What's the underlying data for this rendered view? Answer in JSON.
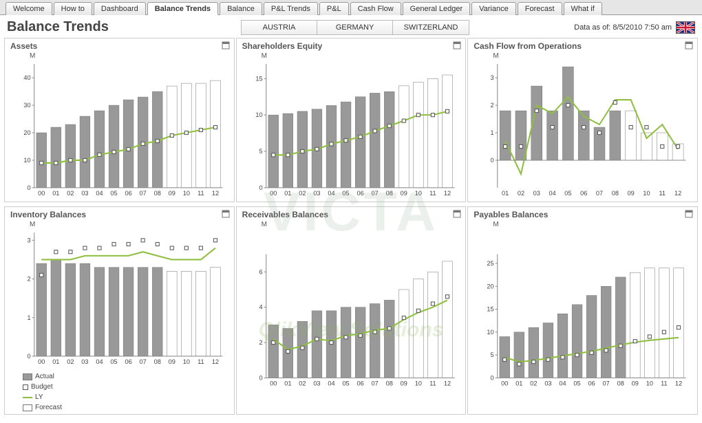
{
  "tabs": [
    "Welcome",
    "How to",
    "Dashboard",
    "Balance Trends",
    "Balance",
    "P&L Trends",
    "P&L",
    "Cash Flow",
    "General Ledger",
    "Variance",
    "Forecast",
    "What if"
  ],
  "active_tab_index": 3,
  "page_title": "Balance Trends",
  "countries": [
    "AUSTRIA",
    "GERMANY",
    "SWITZERLAND"
  ],
  "data_as_of": "Data as of: 8/5/2010 7:50 am",
  "unit": "M",
  "legend": {
    "actual": "Actual",
    "budget": "Budget",
    "ly": "LY",
    "forecast": "Forecast"
  },
  "watermark": "VICTA",
  "watermark2": "QlikView Solutions",
  "chart_data": [
    {
      "title": "Assets",
      "type": "bar",
      "ylim": [
        0,
        45
      ],
      "yticks": [
        0,
        10,
        20,
        30,
        40
      ],
      "categories": [
        "00",
        "01",
        "02",
        "03",
        "04",
        "05",
        "06",
        "07",
        "08",
        "09",
        "10",
        "11",
        "12"
      ],
      "actual": [
        20,
        22,
        23,
        26,
        28,
        30,
        32,
        33,
        35,
        null,
        null,
        null,
        null
      ],
      "forecast": [
        null,
        null,
        null,
        null,
        null,
        null,
        null,
        null,
        null,
        37,
        38,
        38,
        39
      ],
      "budget": [
        9,
        9,
        10,
        10,
        12,
        13,
        14,
        16,
        17,
        19,
        20,
        21,
        22
      ],
      "ly": [
        9,
        9,
        10,
        10,
        12,
        13,
        14,
        16,
        17,
        19,
        20,
        21,
        22
      ]
    },
    {
      "title": "Shareholders Equity",
      "type": "bar",
      "ylim": [
        0,
        17
      ],
      "yticks": [
        0,
        5,
        10,
        15
      ],
      "categories": [
        "00",
        "01",
        "02",
        "03",
        "04",
        "05",
        "06",
        "07",
        "08",
        "09",
        "10",
        "11",
        "12"
      ],
      "actual": [
        10,
        10.2,
        10.5,
        10.8,
        11.3,
        11.8,
        12.5,
        13,
        13.2,
        null,
        null,
        null,
        null
      ],
      "forecast": [
        null,
        null,
        null,
        null,
        null,
        null,
        null,
        null,
        null,
        14,
        14.5,
        15,
        15.5
      ],
      "budget": [
        4.5,
        4.5,
        5,
        5.3,
        6,
        6.5,
        7,
        7.8,
        8.5,
        9.2,
        10,
        10,
        10.5
      ],
      "ly": [
        4.5,
        4.5,
        5,
        5.3,
        6,
        6.5,
        7,
        7.8,
        8.5,
        9.2,
        10,
        10,
        10.5
      ]
    },
    {
      "title": "Cash Flow from Operations",
      "type": "bar",
      "ylim": [
        -1,
        3.5
      ],
      "yticks": [
        0,
        1,
        2,
        3
      ],
      "categories": [
        "01",
        "02",
        "03",
        "04",
        "05",
        "06",
        "07",
        "08",
        "09",
        "10",
        "11",
        "12"
      ],
      "actual": [
        1.8,
        1.8,
        2.7,
        1.8,
        3.4,
        1.8,
        1.2,
        1.8,
        null,
        null,
        null,
        null
      ],
      "forecast": [
        null,
        null,
        null,
        null,
        null,
        null,
        null,
        null,
        1.8,
        1.0,
        1.0,
        0.6
      ],
      "budget": [
        0.5,
        0.5,
        1.8,
        1.2,
        2.0,
        1.2,
        1.0,
        2.1,
        1.2,
        1.2,
        0.5,
        0.5
      ],
      "ly": [
        0.7,
        -0.5,
        2.0,
        1.7,
        2.3,
        1.6,
        1.3,
        2.2,
        2.2,
        0.8,
        1.3,
        0.4
      ]
    },
    {
      "title": "Inventory Balances",
      "type": "bar",
      "ylim": [
        0,
        3.2
      ],
      "yticks": [
        0,
        1,
        2,
        3
      ],
      "categories": [
        "00",
        "01",
        "02",
        "03",
        "04",
        "05",
        "06",
        "07",
        "08",
        "09",
        "10",
        "11",
        "12"
      ],
      "actual": [
        2.4,
        2.5,
        2.4,
        2.4,
        2.3,
        2.3,
        2.3,
        2.3,
        2.3,
        null,
        null,
        null,
        null
      ],
      "forecast": [
        null,
        null,
        null,
        null,
        null,
        null,
        null,
        null,
        null,
        2.2,
        2.2,
        2.2,
        2.3
      ],
      "budget": [
        2.1,
        2.7,
        2.7,
        2.8,
        2.8,
        2.9,
        2.9,
        3.0,
        2.9,
        2.8,
        2.8,
        2.8,
        3.0
      ],
      "ly": [
        2.5,
        2.5,
        2.5,
        2.6,
        2.6,
        2.6,
        2.6,
        2.7,
        2.6,
        2.5,
        2.5,
        2.5,
        2.8
      ]
    },
    {
      "title": "Receivables Balances",
      "type": "bar",
      "ylim": [
        0,
        7
      ],
      "yticks": [
        0,
        2,
        4,
        6
      ],
      "categories": [
        "00",
        "01",
        "02",
        "03",
        "04",
        "05",
        "06",
        "07",
        "08",
        "09",
        "10",
        "11",
        "12"
      ],
      "actual": [
        3.0,
        2.8,
        3.2,
        3.8,
        3.8,
        4.0,
        4.0,
        4.2,
        4.4,
        null,
        null,
        null,
        null
      ],
      "forecast": [
        null,
        null,
        null,
        null,
        null,
        null,
        null,
        null,
        null,
        5.0,
        5.6,
        6.0,
        6.6
      ],
      "budget": [
        2.0,
        1.5,
        1.7,
        2.2,
        2.0,
        2.3,
        2.4,
        2.6,
        2.8,
        3.4,
        3.8,
        4.2,
        4.6
      ],
      "ly": [
        2.2,
        1.6,
        1.8,
        2.2,
        2.1,
        2.4,
        2.5,
        2.7,
        2.8,
        3.3,
        3.7,
        4.0,
        4.4
      ]
    },
    {
      "title": "Payables Balances",
      "type": "bar",
      "ylim": [
        0,
        27
      ],
      "yticks": [
        0,
        5,
        10,
        15,
        20,
        25
      ],
      "categories": [
        "00",
        "01",
        "02",
        "03",
        "04",
        "05",
        "06",
        "07",
        "08",
        "09",
        "10",
        "11",
        "12"
      ],
      "actual": [
        9,
        10,
        11,
        12,
        14,
        16,
        18,
        20,
        22,
        null,
        null,
        null,
        null
      ],
      "forecast": [
        null,
        null,
        null,
        null,
        null,
        null,
        null,
        null,
        null,
        23,
        24,
        24,
        24
      ],
      "budget": [
        4,
        3,
        3.5,
        4,
        4.5,
        5,
        5.5,
        6,
        7,
        8,
        9,
        10,
        11
      ],
      "ly": [
        4.5,
        3.5,
        3.8,
        4.3,
        4.8,
        5.3,
        5.8,
        6.5,
        7.2,
        7.8,
        8.2,
        8.5,
        8.8
      ]
    }
  ]
}
